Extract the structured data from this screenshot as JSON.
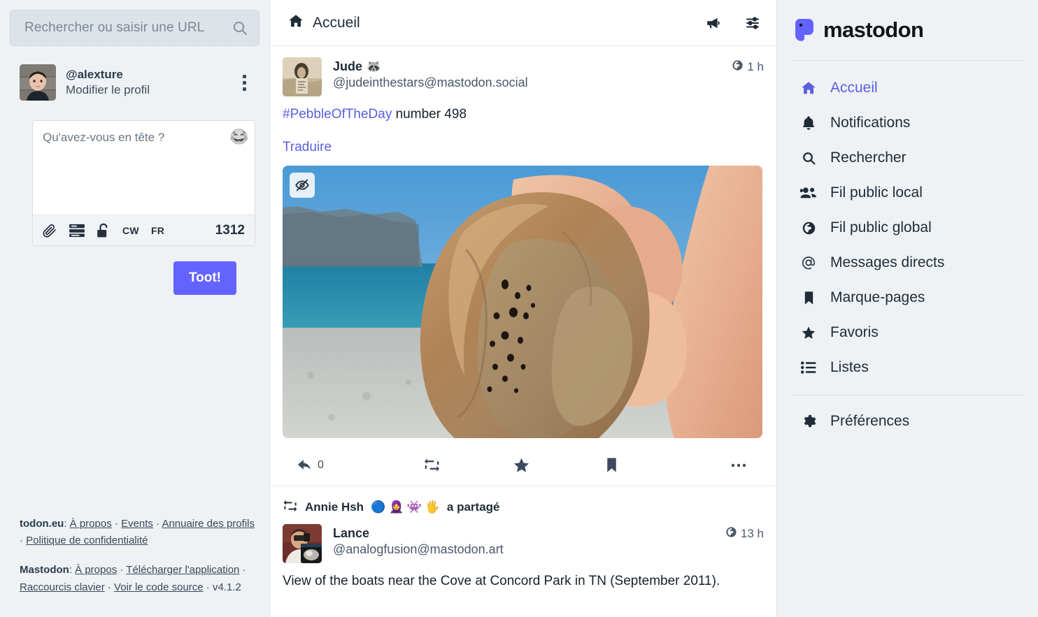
{
  "search": {
    "placeholder": "Rechercher ou saisir une URL",
    "icon": "search-icon"
  },
  "profile": {
    "handle": "@alexture",
    "edit_label": "Modifier le profil",
    "menu_icon": "kebab-menu-icon"
  },
  "compose": {
    "placeholder": "Qu'avez-vous en tête ?",
    "emoji_icon": "emoji-picker-icon",
    "emoji_glyph": "😂",
    "tools": [
      {
        "name": "attach-file-icon",
        "label": ""
      },
      {
        "name": "add-poll-icon",
        "label": ""
      },
      {
        "name": "visibility-unlock-icon",
        "label": ""
      }
    ],
    "cw_label": "CW",
    "lang_label": "FR",
    "char_count": "1312",
    "submit_label": "Toot!"
  },
  "footer": {
    "instance_name": "todon.eu",
    "instance_links": [
      "À propos",
      "Events",
      "Annuaire des profils",
      "Politique de confidentialité"
    ],
    "mastodon_name": "Mastodon",
    "mastodon_links": [
      "À propos",
      "Télécharger l'application",
      "Raccourcis clavier",
      "Voir le code source"
    ],
    "version": "v4.1.2",
    "separator": "·"
  },
  "column": {
    "title": "Accueil",
    "home_icon": "home-icon",
    "actions": [
      {
        "name": "announcements-megaphone-icon"
      },
      {
        "name": "column-settings-sliders-icon"
      }
    ]
  },
  "statuses": [
    {
      "display_name": "Jude",
      "name_emoji": "🦝",
      "acct": "@judeinthestars@mastodon.social",
      "visibility_icon": "globe-icon",
      "time": "1 h",
      "content_hashtag": "#PebbleOfTheDay",
      "content_rest": " number 498",
      "translate_label": "Traduire",
      "media": {
        "alt": "Main tenant un galet de silex brun sur une plage de galets avec falaises et mer turquoise",
        "hide_icon": "eye-slash-icon"
      },
      "actions": {
        "reply_icon": "reply-icon",
        "reply_count": "0",
        "boost_icon": "boost-icon",
        "favourite_icon": "star-icon",
        "bookmark_icon": "bookmark-icon",
        "more_icon": "ellipsis-icon"
      }
    },
    {
      "boost": {
        "icon": "boost-icon",
        "booster_name": "Annie Hsh",
        "booster_emojis": "🔵 🧕 👾 🖐",
        "label": "a partagé"
      },
      "display_name": "Lance",
      "name_emoji": "",
      "acct": "@analogfusion@mastodon.art",
      "visibility_icon": "globe-icon",
      "time": "13 h",
      "content_text": "View of the boats near the Cove at Concord Park in TN (September 2011)."
    }
  ],
  "brand": {
    "name": "mastodon",
    "logo_icon": "mastodon-logo-icon"
  },
  "nav": {
    "items": [
      {
        "label": "Accueil",
        "icon": "home-icon",
        "active": true
      },
      {
        "label": "Notifications",
        "icon": "bell-icon",
        "active": false
      },
      {
        "label": "Rechercher",
        "icon": "search-icon",
        "active": false
      },
      {
        "label": "Fil public local",
        "icon": "users-icon",
        "active": false
      },
      {
        "label": "Fil public global",
        "icon": "globe-icon",
        "active": false
      },
      {
        "label": "Messages directs",
        "icon": "at-icon",
        "active": false
      },
      {
        "label": "Marque-pages",
        "icon": "bookmark-icon",
        "active": false
      },
      {
        "label": "Favoris",
        "icon": "star-icon",
        "active": false
      },
      {
        "label": "Listes",
        "icon": "list-icon",
        "active": false
      }
    ],
    "preferences": {
      "label": "Préférences",
      "icon": "gear-icon"
    }
  },
  "colors": {
    "accent": "#6364ff",
    "link": "#5a5fe0",
    "background": "#eef2f5",
    "panel": "#ffffff",
    "text": "#1f2b37",
    "muted": "#4a5869"
  }
}
